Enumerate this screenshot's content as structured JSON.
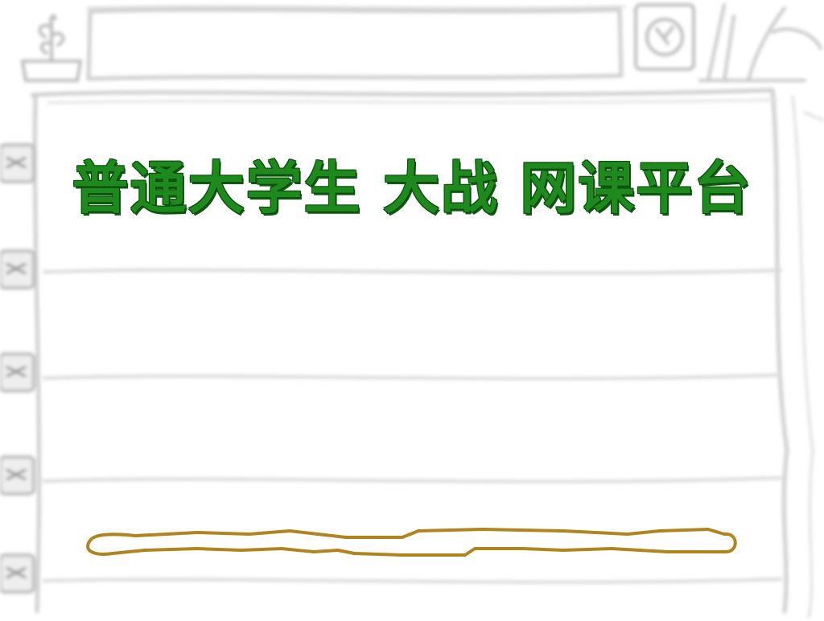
{
  "slide": {
    "title": "普通大学生 大战 网课平台"
  },
  "colors": {
    "background": "#ffffff",
    "sketch_line": "#c9c9c9",
    "title_fill": "#1e8a1e",
    "title_outline": "#0b4a0b",
    "underline_stroke": "#b0841e"
  },
  "icons": {
    "top_left": "potted-plant-icon",
    "top_right": "clock-icon",
    "top_far_right": "pencil-cup-icon",
    "left_edge": "spiral-ring-icon"
  }
}
